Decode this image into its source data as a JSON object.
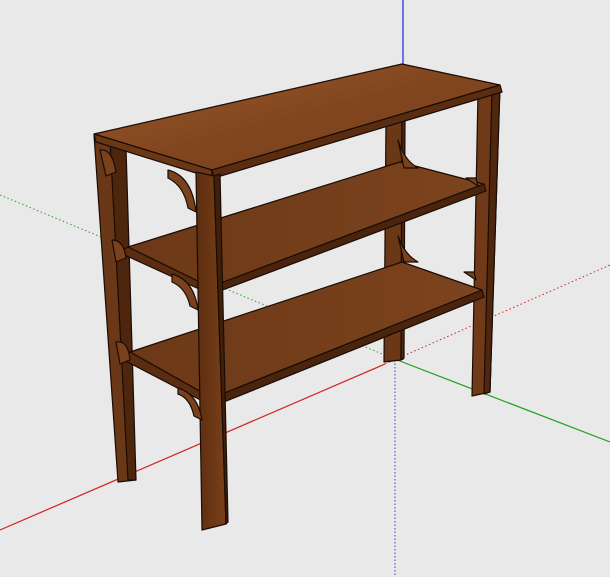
{
  "app": {
    "type": "3d-modeling-viewport",
    "background_color": "#e9e9e9"
  },
  "axes": {
    "red_color": "#d42020",
    "green_color": "#1fa01f",
    "blue_color": "#2020d8"
  },
  "model": {
    "object": "shelf-unit",
    "shelf_count": 3,
    "wood_colors": {
      "top_light": "#8a4f25",
      "top_dark": "#6e3a18",
      "leg_front": "#6a3717",
      "leg_side": "#4e260e",
      "edge_line": "#1a0c05"
    }
  }
}
